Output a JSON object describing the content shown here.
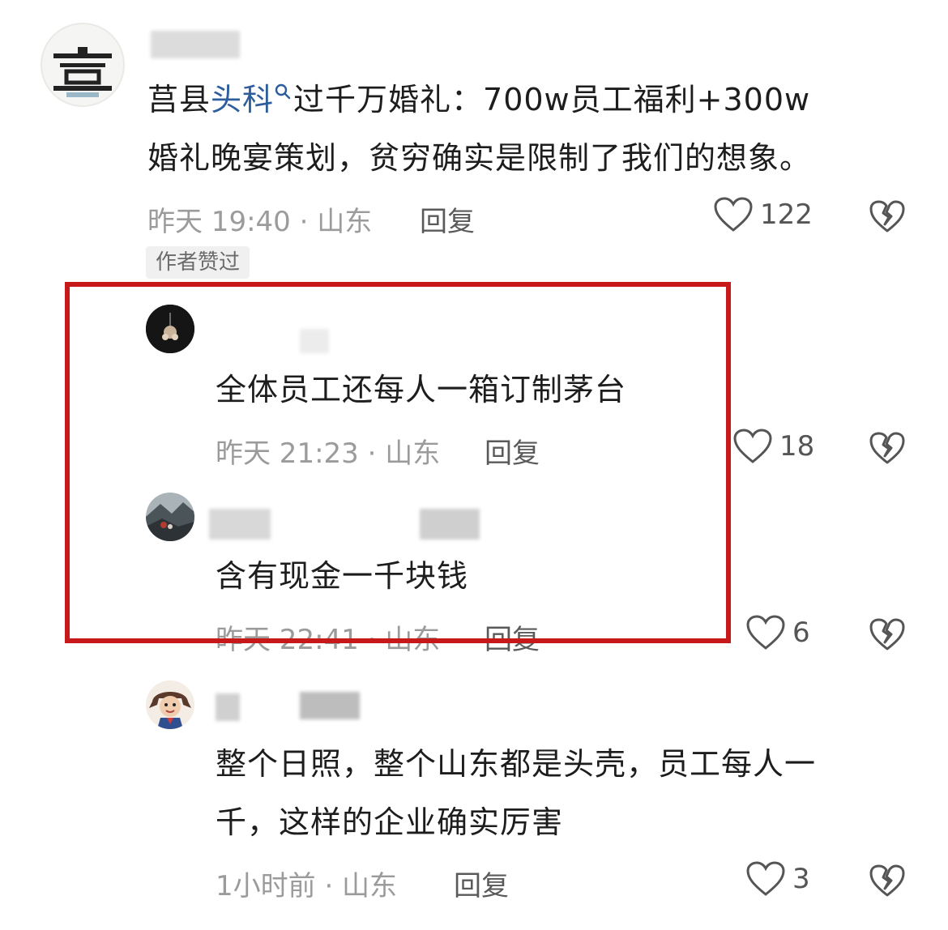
{
  "comments": [
    {
      "text_pre": "莒县",
      "text_link": "头科",
      "text_post_line1": "过千万婚礼：700w员工福利+300w",
      "text_line2": "婚礼晚宴策划，贫穷确实是限制了我们的想象。",
      "meta": "昨天 19:40 · 山东",
      "reply_label": "回复",
      "likes": "122",
      "badge": "作者赞过"
    },
    {
      "text": "全体员工还每人一箱订制茅台",
      "meta": "昨天 21:23 · 山东",
      "reply_label": "回复",
      "likes": "18"
    },
    {
      "text": "含有现金一千块钱",
      "meta": "昨天 22:41 · 山东",
      "reply_label": "回复",
      "likes": "6"
    },
    {
      "text_line1": "整个日照，整个山东都是头壳，员工每人一",
      "text_line2": "千，这样的企业确实厉害",
      "meta": "1小时前 · 山东",
      "reply_label": "回复",
      "likes": "3"
    }
  ],
  "icons": {
    "like": "heart-outline-icon",
    "dislike": "broken-heart-icon",
    "search": "search-icon"
  },
  "colors": {
    "link": "#2d5d9c",
    "highlight": "#c8191a",
    "meta": "#9b9b9b"
  }
}
